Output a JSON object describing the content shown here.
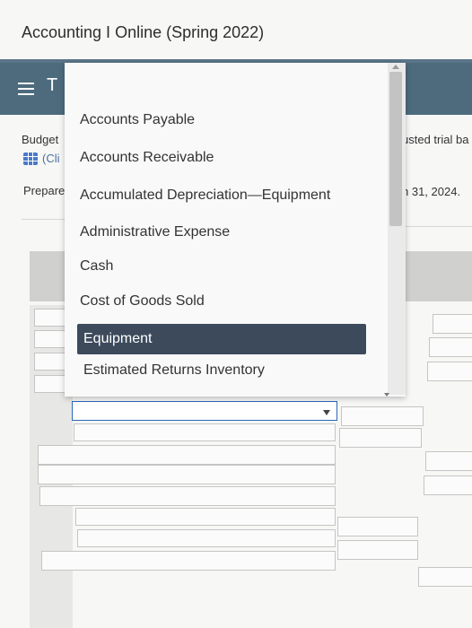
{
  "header": {
    "title": "Accounting I Online (Spring 2022)"
  },
  "nav": {
    "partial_label": "T"
  },
  "content": {
    "budget_label": "Budget",
    "cli_label": "(Cli",
    "prepare_label": "Prepare",
    "right_text_1": "usted trial ba",
    "right_text_2": "h 31, 2024."
  },
  "dropdown": {
    "items": [
      "Accounts Payable",
      "Accounts Receivable",
      "Accumulated Depreciation—Equipment",
      "Administrative Expense",
      "Cash",
      "Cost of Goods Sold",
      "Equipment",
      "Estimated Returns Inventory"
    ],
    "selected": "Equipment"
  },
  "select": {
    "value": ""
  },
  "icons": {
    "menu": "hamburger-icon",
    "grid": "grid-icon",
    "dropdown_arrow": "chevron-down-icon"
  },
  "colors": {
    "navbar": "#4d6b7d",
    "selected_item": "#3c4a5c",
    "select_border": "#2a68b8"
  }
}
